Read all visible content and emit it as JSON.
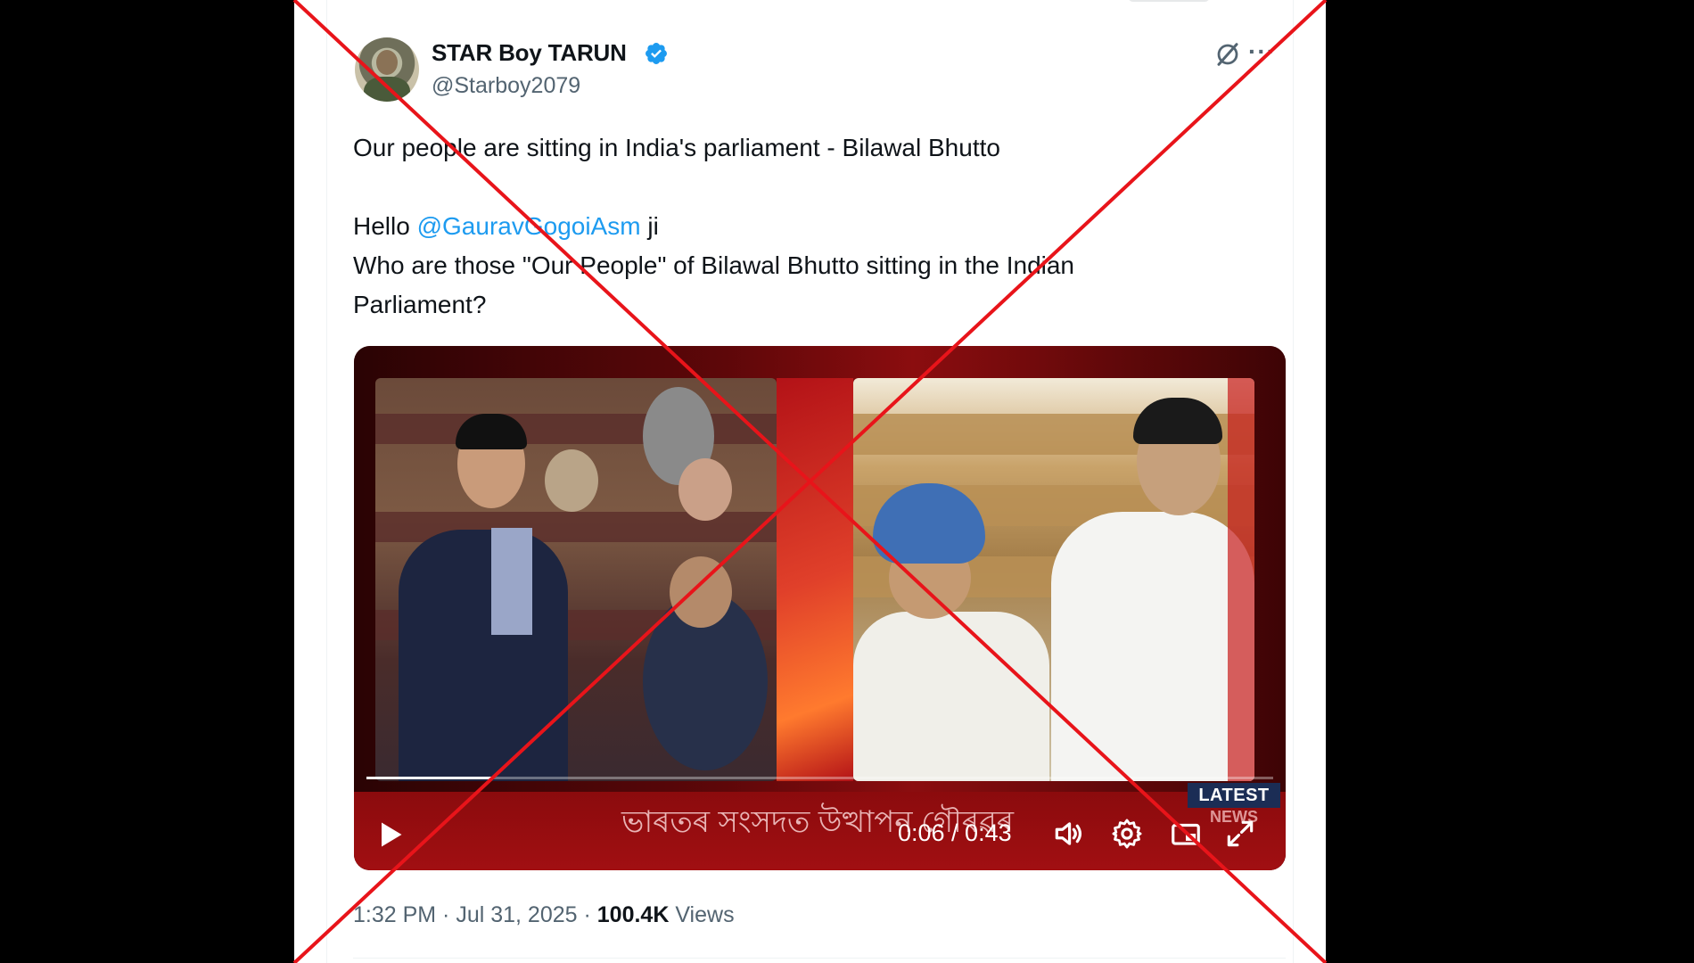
{
  "tweet": {
    "author": {
      "display_name": "STAR Boy TARUN",
      "handle": "@Starboy2079",
      "verified": true
    },
    "line1": "Our people are sitting in India's parliament - Bilawal Bhutto",
    "line2_prefix": "Hello ",
    "mention": "@GauravGogoiAsm",
    "line2_suffix": " ji",
    "line3": "Who are those \"Our People\" of Bilawal Bhutto sitting in the Indian",
    "line4": "Parliament?",
    "video": {
      "ticker_text": "ভাৰতৰ সংসদত উত্থাপন গৌৰৱৰ",
      "badge_top": "LATEST",
      "badge_bottom": "NEWS",
      "time_display": "0:06 / 0:43",
      "progress": 0.14
    },
    "meta": {
      "time": "1:32 PM",
      "separator": " · ",
      "date": "Jul 31, 2025",
      "views_count": "100.4K",
      "views_label": " Views"
    }
  },
  "colors": {
    "accent_blue": "#1d9bf0",
    "text_primary": "#0f1419",
    "text_secondary": "#536471",
    "overlay_red": "#e8141a"
  },
  "icons": [
    "verified-badge-icon",
    "grok-icon",
    "more-icon",
    "play-icon",
    "volume-icon",
    "settings-icon",
    "pip-icon",
    "fullscreen-icon"
  ]
}
